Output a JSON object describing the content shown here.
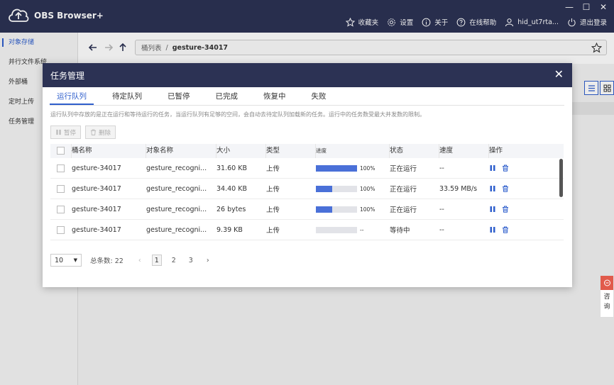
{
  "app": {
    "title": "OBS Browser+"
  },
  "topnav": {
    "favorites": "收藏夹",
    "settings": "设置",
    "about": "关于",
    "help": "在线帮助",
    "user": "hid_ut7rta...",
    "logout": "退出登录"
  },
  "sidebar": {
    "items": [
      {
        "label": "对象存储"
      },
      {
        "label": "并行文件系统"
      },
      {
        "label": "外部桶"
      },
      {
        "label": "定时上传"
      },
      {
        "label": "任务管理"
      }
    ]
  },
  "path": {
    "root": "桶列表",
    "current": "gesture-34017"
  },
  "modal": {
    "title": "任务管理",
    "tabs": [
      "运行队列",
      "待定队列",
      "已暂停",
      "已完成",
      "恢复中",
      "失败"
    ],
    "description": "运行队列中存放的是正在运行和等待运行的任务，当运行队列有足够的空间，会自动去待定队列加载新的任务。运行中的任务数受最大并发数的限制。",
    "buttons": {
      "pause": "暂停",
      "delete": "删除"
    },
    "columns": [
      "桶名称",
      "对象名称",
      "大小",
      "类型",
      "进度",
      "状态",
      "速度",
      "操作"
    ],
    "rows": [
      {
        "bucket": "gesture-34017",
        "object": "gesture_recogni...",
        "size": "31.60 KB",
        "type": "上传",
        "progress": 100,
        "progress_text": "100%",
        "status": "正在运行",
        "speed": "--"
      },
      {
        "bucket": "gesture-34017",
        "object": "gesture_recogni...",
        "size": "34.40 KB",
        "type": "上传",
        "progress": 40,
        "progress_text": "100%",
        "status": "正在运行",
        "speed": "33.59 MB/s"
      },
      {
        "bucket": "gesture-34017",
        "object": "gesture_recogni...",
        "size": "26 bytes",
        "type": "上传",
        "progress": 40,
        "progress_text": "100%",
        "status": "正在运行",
        "speed": "--"
      },
      {
        "bucket": "gesture-34017",
        "object": "gesture_recogni...",
        "size": "9.39 KB",
        "type": "上传",
        "progress": 0,
        "progress_text": "--",
        "status": "等待中",
        "speed": "--"
      }
    ],
    "pager": {
      "page_size": "10",
      "total": "总条数: 22",
      "pages": [
        "1",
        "2",
        "3"
      ],
      "current": "1"
    }
  },
  "consult": {
    "label": "咨询"
  },
  "colors": {
    "titlebar": "#2c3254",
    "accent": "#2f5fcc",
    "progress": "#4a70d8",
    "consult": "#e15a4b"
  }
}
